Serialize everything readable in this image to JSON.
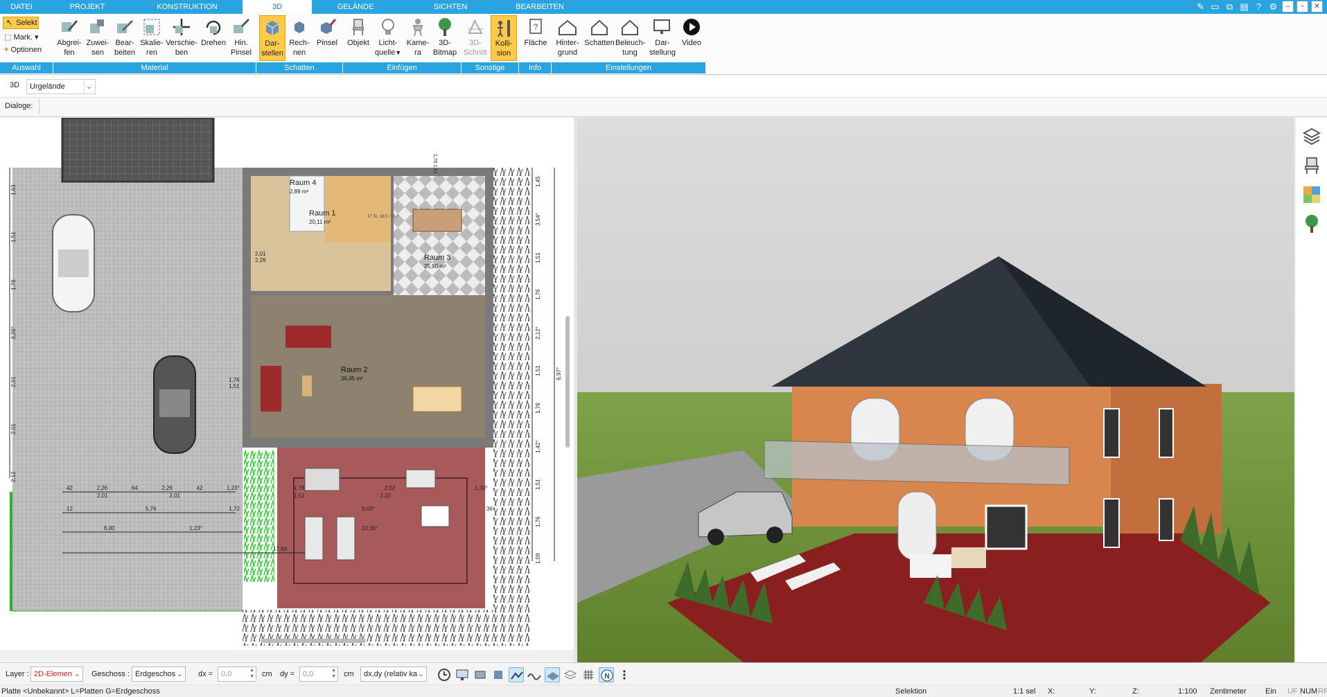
{
  "tabs": [
    "DATEI",
    "PROJEKT",
    "KONSTRUKTION",
    "3D",
    "GELÄNDE",
    "SICHTEN",
    "BEARBEITEN"
  ],
  "active_tab": "3D",
  "ribbon": {
    "auswahl": {
      "selekt": "Selekt",
      "mark": "Mark.",
      "optionen": "Optionen"
    },
    "buttons": [
      {
        "id": "abgreifen",
        "label1": "Abgrei-",
        "label2": "fen"
      },
      {
        "id": "zuweisen",
        "label1": "Zuwei-",
        "label2": "sen"
      },
      {
        "id": "bearbeiten",
        "label1": "Bear-",
        "label2": "beiten"
      },
      {
        "id": "skalieren",
        "label1": "Skalie-",
        "label2": "ren"
      },
      {
        "id": "verschieben",
        "label1": "Verschie-",
        "label2": "ben"
      },
      {
        "id": "drehen",
        "label1": "Drehen",
        "label2": ""
      },
      {
        "id": "hin-pinsel",
        "label1": "Hin.",
        "label2": "Pinsel"
      },
      {
        "id": "darstellen",
        "label1": "Dar-",
        "label2": "stellen"
      },
      {
        "id": "rechnen",
        "label1": "Rech-",
        "label2": "nen"
      },
      {
        "id": "pinsel",
        "label1": "Pinsel",
        "label2": ""
      },
      {
        "id": "objekt",
        "label1": "Objekt",
        "label2": ""
      },
      {
        "id": "lichtquelle",
        "label1": "Licht-",
        "label2": "quelle"
      },
      {
        "id": "kamera",
        "label1": "Kame-",
        "label2": "ra"
      },
      {
        "id": "bitmap3d",
        "label1": "3D-",
        "label2": "Bitmap"
      },
      {
        "id": "schnitt3d",
        "label1": "3D-",
        "label2": "Schnitt"
      },
      {
        "id": "kollision",
        "label1": "Kolli-",
        "label2": "sion"
      },
      {
        "id": "flaeche",
        "label1": "Fläche",
        "label2": ""
      },
      {
        "id": "hintergrund",
        "label1": "Hinter-",
        "label2": "grund"
      },
      {
        "id": "schatten",
        "label1": "Schatten",
        "label2": ""
      },
      {
        "id": "beleuchtung",
        "label1": "Beleuch-",
        "label2": "tung"
      },
      {
        "id": "darstellung",
        "label1": "Dar-",
        "label2": "stellung"
      },
      {
        "id": "video",
        "label1": "Video",
        "label2": ""
      }
    ],
    "groups": [
      "Auswahl",
      "Material",
      "Schatten",
      "Einfügen",
      "Sonstige",
      "Info",
      "Einstellungen"
    ]
  },
  "row2": {
    "mode": "3D",
    "dropdown": "Urgelände"
  },
  "row3": {
    "label": "Dialoge:"
  },
  "plan": {
    "rooms": [
      {
        "name": "Raum 4",
        "area": "2,89 m²"
      },
      {
        "name": "Raum 1",
        "area": "20,11 m²"
      },
      {
        "name": "Raum 3",
        "area": "25,90 m²"
      },
      {
        "name": "Raum 2",
        "area": "36,45 m²"
      }
    ],
    "dims_left": [
      "2,12",
      "2,01",
      "2,01",
      "3,26°",
      "1,76",
      "1,51",
      "1,63"
    ],
    "dims_right": [
      "1,09",
      "1,76",
      "1,51",
      "1,42°",
      "1,76",
      "1,51",
      "2,12°",
      "1,76",
      "1,51",
      "3,54°",
      "1,45",
      "6,97°"
    ],
    "dims_bottom": [
      "42",
      "2,26",
      "64",
      "2,26",
      "42",
      "1,23°",
      "2,01",
      "2,01",
      "12",
      "5,76",
      "1,72",
      "6,00",
      "1,23°",
      "17,60"
    ],
    "dims_patio": [
      "1,78",
      "1,51",
      "2,02",
      "2,20",
      "1,30°",
      "9,63°",
      "10,36°",
      "36"
    ],
    "dims_top": [
      "1,76",
      "1,51"
    ],
    "door_labels": [
      "2,01",
      "2,26",
      "2,01",
      "2,26",
      "1,76",
      "1,51"
    ],
    "stair_text": "17 St. 18,9 / 33,7"
  },
  "bottom": {
    "layer_label": "Layer :",
    "layer_value": "2D-Elemen",
    "geschoss_label": "Geschoss :",
    "geschoss_value": "Erdgeschos",
    "dx_label": "dx =",
    "dx_value": "0,0",
    "dx_unit": "cm",
    "dy_label": "dy =",
    "dy_value": "0,0",
    "dy_unit": "cm",
    "rel_value": "dx,dy (relativ ka"
  },
  "status": {
    "left": "Platte <Unbekannt> L=Platten G=Erdgeschoss",
    "selektion": "Selektion",
    "sel": "1:1 sel",
    "x": "X:",
    "y": "Y:",
    "z": "Z:",
    "scale": "1:100",
    "unit": "Zentimeter",
    "ein": "Ein",
    "uf": "UF",
    "num": "NUM",
    "rf": "RF"
  },
  "colors": {
    "accent": "#2aa4e0",
    "active_button": "#ffc94a",
    "wall": "#7a7a7a",
    "floor_brown": "#d8c39a",
    "floor_room2": "#8d8170",
    "patio": "#a85a5a",
    "roof": "#2f3640",
    "facade": "#d9854e",
    "grass": "#6f8f3a"
  }
}
